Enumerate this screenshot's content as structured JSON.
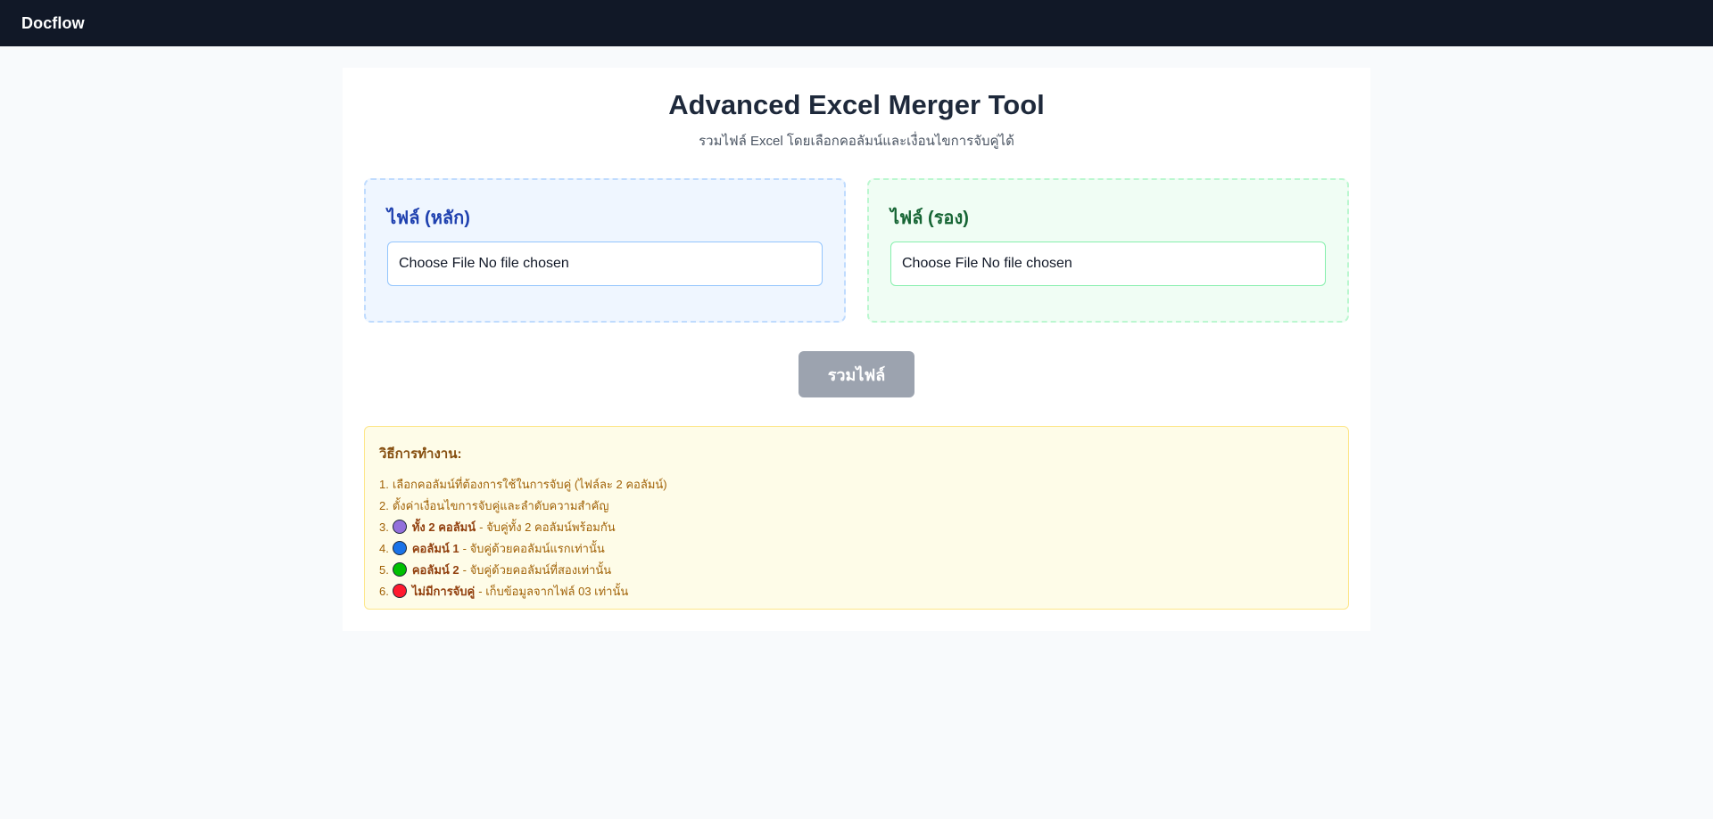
{
  "navbar": {
    "brand": "Docflow"
  },
  "header": {
    "title": "Advanced Excel Merger Tool",
    "subtitle": "รวมไฟล์ Excel โดยเลือกคอลัมน์และเงื่อนไขการจับคู่ได้"
  },
  "uploads": {
    "main": {
      "label": "ไฟล์ (หลัก)",
      "choose_label": "Choose File",
      "status": "No file chosen"
    },
    "secondary": {
      "label": "ไฟล์ (รอง)",
      "choose_label": "Choose File",
      "status": "No file chosen"
    }
  },
  "merge_button": {
    "label": "รวมไฟล์"
  },
  "instructions": {
    "title": "วิธีการทำงาน:",
    "items": [
      {
        "num": "1.",
        "text": "เลือกคอลัมน์ที่ต้องการใช้ในการจับคู่ (ไฟล์ละ 2 คอลัมน์)"
      },
      {
        "num": "2.",
        "text": "ตั้งค่าเงื่อนไขการจับคู่และลำดับความสำคัญ"
      },
      {
        "num": "3.",
        "bold": "ทั้ง 2 คอลัมน์",
        "text": "- จับคู่ทั้ง 2 คอลัมน์พร้อมกัน",
        "dot_color": "#9370db"
      },
      {
        "num": "4.",
        "bold": "คอลัมน์ 1",
        "text": "- จับคู่ด้วยคอลัมน์แรกเท่านั้น",
        "dot_color": "#1a73e8"
      },
      {
        "num": "5.",
        "bold": "คอลัมน์ 2",
        "text": "- จับคู่ด้วยคอลัมน์ที่สองเท่านั้น",
        "dot_color": "#00c000"
      },
      {
        "num": "6.",
        "bold": "ไม่มีการจับคู่",
        "text": "- เก็บข้อมูลจากไฟล์ 03 เท่านั้น",
        "dot_color": "#ff1a2e"
      }
    ]
  },
  "colors": {
    "navbar_bg": "#111827",
    "main_upload_accent": "#1e40af",
    "secondary_upload_accent": "#166534",
    "merge_button_disabled": "#9ca3af",
    "instructions_bg": "#fefce8"
  }
}
